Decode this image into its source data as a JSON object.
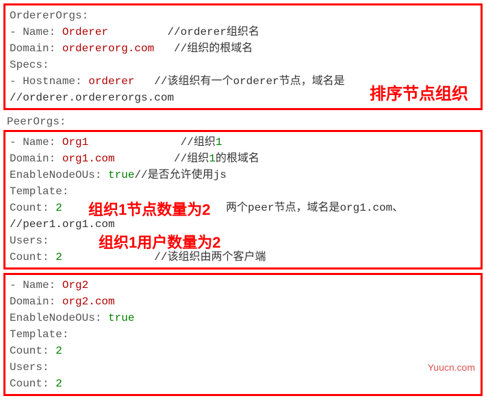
{
  "block1": {
    "l1": "OrdererOrgs:",
    "l2a": "- Name: ",
    "l2b": "Orderer",
    "l2c": "         //orderer组织名",
    "l3a": "Domain: ",
    "l3b": "ordererorg.com",
    "l3c": "   //组织的根域名",
    "l4": "Specs:",
    "l5a": "- Hostname: ",
    "l5b": "orderer",
    "l5c": "   //该组织有一个orderer节点，域名是",
    "l6": "//orderer.ordererorgs.com",
    "note": "排序节点组织"
  },
  "between": {
    "l1": "PeerOrgs:"
  },
  "block2": {
    "l1a": "- Name: ",
    "l1b": "Org1",
    "l1c": "              //组织",
    "l1d": "1",
    "l2a": "Domain: ",
    "l2b": "org1.com",
    "l2c": "         //组织",
    "l2d": "1",
    "l2e": "的根域名",
    "l3a": "EnableNodeOUs: ",
    "l3b": "true",
    "l3c": "//是否允许使用js",
    "l4": "Template:",
    "l5a": "Count: ",
    "l5b": "2",
    "l5c_pre": "  ",
    "l5c": "两个peer节点，域名是org1.com、",
    "l6": "//peer1.org1.com",
    "l7": "Users:",
    "l8a": "Count: ",
    "l8b": "2",
    "l8c": "              //该组织由两个客户端",
    "note1a": "组织1节点数量为",
    "note1b": "2",
    "note2a": "组织1用户数量为",
    "note2b": "2"
  },
  "block3": {
    "l1a": "- Name: ",
    "l1b": "Org2",
    "l2a": "Domain: ",
    "l2b": "org2.com",
    "l3a": "EnableNodeOUs: ",
    "l3b": "true",
    "l4": "Template:",
    "l5a": "Count: ",
    "l5b": "2",
    "l6": "Users:",
    "l7a": "Count: ",
    "l7b": "2"
  },
  "watermark": "Yuucn.com"
}
